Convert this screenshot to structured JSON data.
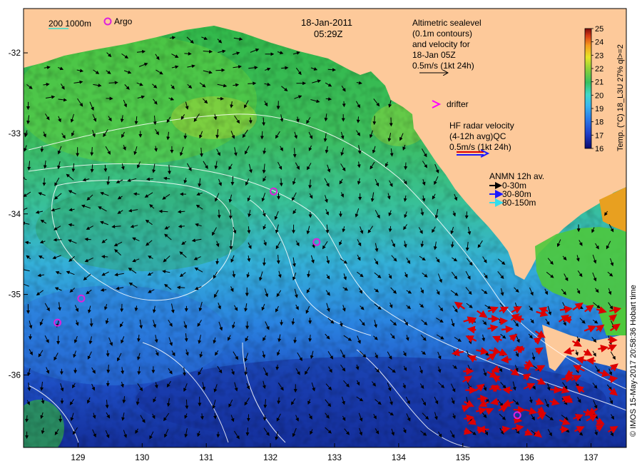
{
  "title": {
    "date": "18-Jan-2011",
    "time": "05:29Z"
  },
  "scale_legend": {
    "depths": "200  1000m",
    "argo": "Argo"
  },
  "altimetry_note": [
    "Altimetric sealevel",
    "(0.1m contours)",
    "and velocity for",
    "18-Jan 05Z",
    "0.5m/s (1kt 24h)"
  ],
  "drifter_label": "drifter",
  "hf_radar": [
    "HF radar velocity",
    "(4-12h avg)QC",
    "0.5m/s (1kt 24h)"
  ],
  "anmn": {
    "title": "ANMN 12h av.",
    "entries": [
      {
        "label": "0-30m",
        "color": "#000000"
      },
      {
        "label": "30-80m",
        "color": "#1a1aff"
      },
      {
        "label": "80-150m",
        "color": "#33ddee"
      }
    ]
  },
  "colorbar": {
    "title": "Temp. (°C) 18_L3U 27% ql>=2",
    "min": 16,
    "max": 25,
    "ticks": [
      "25",
      "24",
      "23",
      "22",
      "21",
      "20",
      "19",
      "18",
      "17",
      "16"
    ]
  },
  "credit": "© IMOS 15-May-2017 20:58:36 Hobart time",
  "axes": {
    "x_ticks": [
      "129",
      "130",
      "131",
      "132",
      "133",
      "134",
      "135",
      "136",
      "137"
    ],
    "y_ticks": [
      "-32",
      "-33",
      "-34",
      "-35",
      "-36"
    ],
    "lon_range": [
      128.15,
      137.55
    ],
    "lat_range": [
      -36.9,
      -31.45
    ]
  },
  "colors": {
    "land": "#fdc99a",
    "argo": "#dd22dd",
    "drifter": "#ff00ff",
    "hf_arrow": "#dd0000",
    "contour": "#ffffff",
    "legend_line": "#33ddcc"
  },
  "argo_floats": [
    {
      "lon": 132.05,
      "lat": -33.72
    },
    {
      "lon": 132.72,
      "lat": -34.35
    },
    {
      "lon": 129.05,
      "lat": -35.05
    },
    {
      "lon": 128.68,
      "lat": -35.35
    },
    {
      "lon": 135.85,
      "lat": -36.5
    }
  ]
}
